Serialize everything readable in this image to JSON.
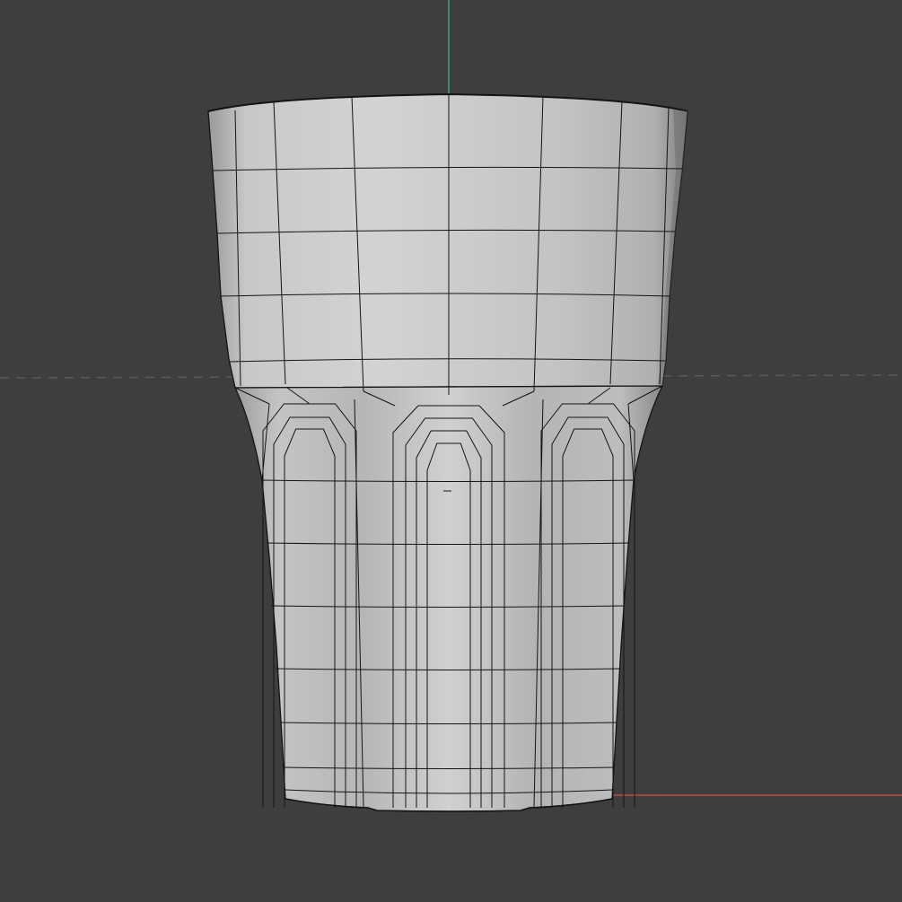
{
  "viewport": {
    "view": "front",
    "shading": "solid-with-wireframe",
    "background_color": "#3e3e3e",
    "grid_line_color": "#5a5a5a"
  },
  "axes": {
    "x_axis_color": "#d84a4a",
    "y_axis_color": "#3fbf7f"
  },
  "model": {
    "shape": "fluted-tumbler-glass",
    "wire_color": "#141414",
    "surface_light": "#d3d3d3",
    "surface_mid": "#b9b9b9",
    "surface_dark": "#8f8f8f"
  }
}
